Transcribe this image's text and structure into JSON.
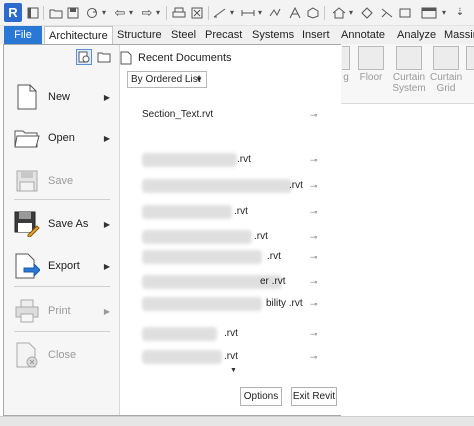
{
  "qat": {
    "logo": "R",
    "icons": [
      "app-menu-icon",
      "open-icon",
      "save-icon",
      "sync-icon",
      "undo-icon",
      "redo-icon",
      "print-icon",
      "measure-icon",
      "dimension-icon",
      "tag-icon",
      "text-icon",
      "home-view-icon",
      "section-icon",
      "close-windows-icon",
      "switch-windows-icon"
    ]
  },
  "tabs": [
    "File",
    "Architecture",
    "Structure",
    "Steel",
    "Precast",
    "Systems",
    "Insert",
    "Annotate",
    "Analyze",
    "Massing"
  ],
  "ribbon_bg": {
    "items": [
      "g",
      "Floor",
      "Curtain System",
      "Curtain Grid"
    ]
  },
  "menu": {
    "items": [
      {
        "label": "New",
        "has_arrow": true,
        "enabled": true
      },
      {
        "label": "Open",
        "has_arrow": true,
        "enabled": true
      },
      {
        "label": "Save",
        "has_arrow": false,
        "enabled": false
      },
      {
        "label": "Save As",
        "has_arrow": true,
        "enabled": true
      },
      {
        "label": "Export",
        "has_arrow": true,
        "enabled": true
      },
      {
        "label": "Print",
        "has_arrow": true,
        "enabled": false
      },
      {
        "label": "Close",
        "has_arrow": false,
        "enabled": false
      }
    ]
  },
  "recent": {
    "title": "Recent Documents",
    "sort_value": "By Ordered List",
    "documents": [
      "Section_Text.rvt",
      ".rvt",
      ".rvt",
      ".rvt",
      ".rvt",
      ".rvt",
      "er .rvt",
      "bility .rvt",
      ".rvt",
      ".rvt"
    ]
  },
  "buttons": {
    "options": "Options",
    "exit": "Exit Revit"
  },
  "colors": {
    "file_tab": "#2a78d6",
    "panel_bg": "#f6f6f6"
  }
}
